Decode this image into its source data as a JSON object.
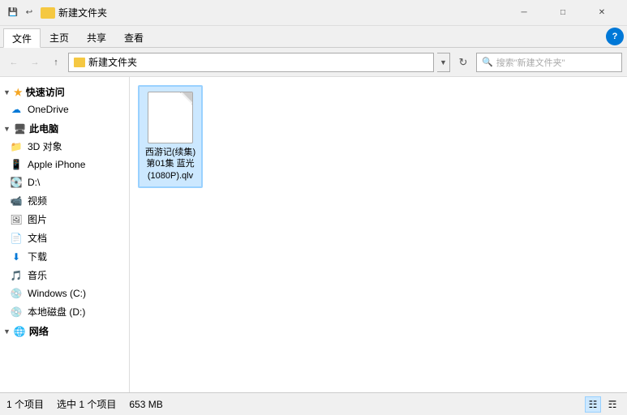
{
  "titlebar": {
    "title": "新建文件夹",
    "minimize": "─",
    "maximize": "□",
    "close": "✕"
  },
  "ribbon": {
    "tabs": [
      "文件",
      "主页",
      "共享",
      "查看"
    ]
  },
  "addressbar": {
    "path": "新建文件夹",
    "search_placeholder": "搜索\"新建文件夹\"",
    "help": "?"
  },
  "sidebar": {
    "sections": [
      {
        "label": "快速访问",
        "expanded": true,
        "items": []
      }
    ],
    "items": [
      {
        "label": "OneDrive",
        "icon": "onedrive"
      },
      {
        "label": "此电脑",
        "icon": "pc"
      },
      {
        "label": "3D 对象",
        "icon": "folder"
      },
      {
        "label": "Apple iPhone",
        "icon": "phone"
      },
      {
        "label": "D:\\",
        "icon": "drive"
      },
      {
        "label": "视频",
        "icon": "video"
      },
      {
        "label": "图片",
        "icon": "pic"
      },
      {
        "label": "文档",
        "icon": "doc"
      },
      {
        "label": "下载",
        "icon": "download"
      },
      {
        "label": "音乐",
        "icon": "music"
      },
      {
        "label": "Windows (C:)",
        "icon": "windows-drive"
      },
      {
        "label": "本地磁盘 (D:)",
        "icon": "local-disk"
      },
      {
        "label": "网络",
        "icon": "network"
      }
    ]
  },
  "files": [
    {
      "name": "西游记(续集) 第01集 蓝光 (1080P).qlv",
      "selected": true
    }
  ],
  "statusbar": {
    "count": "1 个项目",
    "selected": "选中 1 个项目",
    "size": "653 MB"
  }
}
